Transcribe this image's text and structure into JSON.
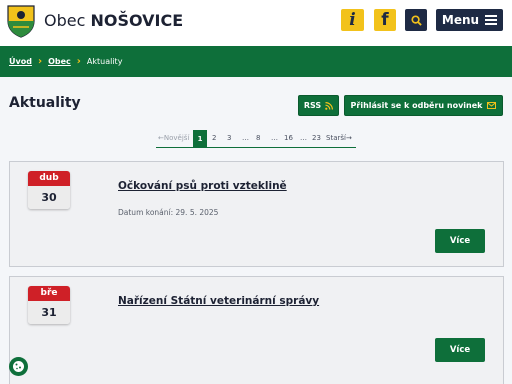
{
  "header": {
    "title_prefix": "Obec",
    "title_name": "NOŠOVICE",
    "info_label": "i",
    "facebook_label": "f",
    "menu_label": "Menu",
    "crest_icon": "coat-of-arms-icon",
    "search_icon": "search-icon",
    "menu_icon": "hamburger-icon"
  },
  "breadcrumb": {
    "items": [
      "Úvod",
      "Obec"
    ],
    "current": "Aktuality"
  },
  "page": {
    "title": "Aktuality",
    "rss_label": "RSS",
    "subscribe_label": "Přihlásit se k odběru novinek"
  },
  "pagination": {
    "prev": "←Novější",
    "pages": [
      "1",
      "2",
      "3",
      "…",
      "8",
      "…",
      "16",
      "…",
      "23"
    ],
    "current": "1",
    "next": "Starší→"
  },
  "articles": [
    {
      "month": "dub",
      "day": "30",
      "title": "Očkování psů proti vzteklině",
      "meta": "Datum konání: 29. 5. 2025",
      "more_label": "Více"
    },
    {
      "month": "bře",
      "day": "31",
      "title": "Nařízení Státní veterinární správy",
      "more_label": "Více"
    }
  ],
  "colors": {
    "brand_green": "#0e6f3a",
    "accent_yellow": "#f2c21b",
    "navy": "#1e2a44",
    "date_red": "#cf2027"
  }
}
